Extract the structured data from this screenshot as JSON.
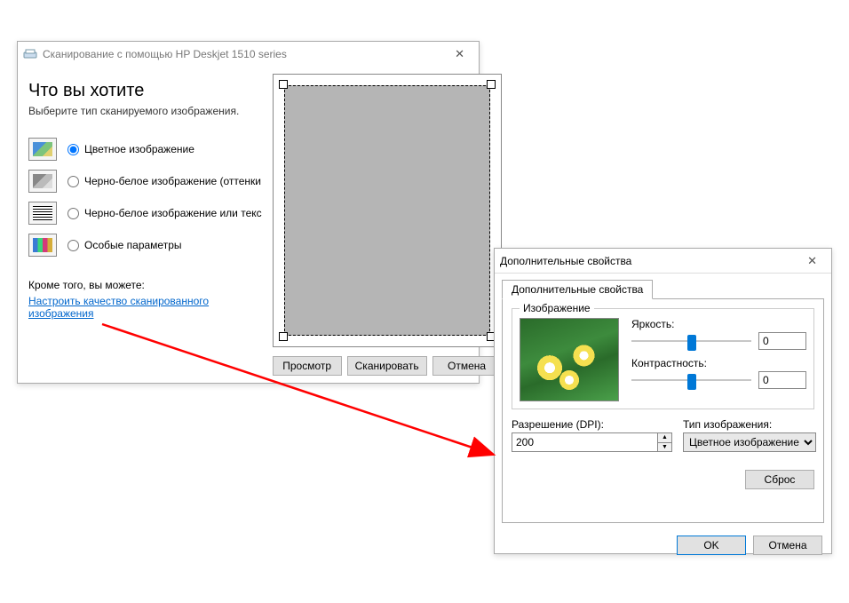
{
  "scan_window": {
    "title": "Сканирование с помощью HP Deskjet 1510 series",
    "heading": "Что вы хотите",
    "description": "Выберите тип сканируемого изображения.",
    "options": {
      "color": "Цветное изображение",
      "gray": "Черно-белое изображение (оттенки",
      "bw": "Черно-белое изображение или текс",
      "custom": "Особые параметры"
    },
    "also_text": "Кроме того, вы можете:",
    "link_text": "Настроить качество сканированного изображения",
    "buttons": {
      "preview": "Просмотр",
      "scan": "Сканировать",
      "cancel": "Отмена"
    }
  },
  "prop_window": {
    "title": "Дополнительные свойства",
    "tab_label": "Дополнительные свойства",
    "group_image": "Изображение",
    "brightness_label": "Яркость:",
    "brightness_value": "0",
    "contrast_label": "Контрастность:",
    "contrast_value": "0",
    "resolution_label": "Разрешение (DPI):",
    "resolution_value": "200",
    "type_label": "Тип изображения:",
    "type_value": "Цветное изображение",
    "reset": "Сброс",
    "ok": "OK",
    "cancel": "Отмена"
  }
}
